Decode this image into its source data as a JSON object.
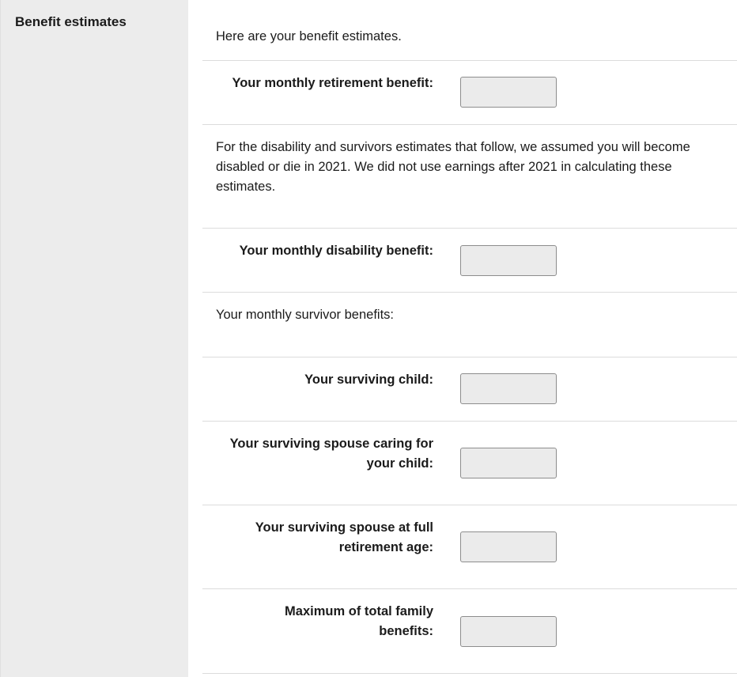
{
  "sidebar": {
    "heading": "Benefit estimates"
  },
  "main": {
    "intro": "Here are your benefit estimates.",
    "retirement": {
      "label": "Your monthly retirement benefit:",
      "value": ""
    },
    "disability_note": "For the disability and survivors estimates that follow, we assumed you will become disabled or die in 2021. We did not use earnings after 2021 in calculating these estimates.",
    "disability": {
      "label": "Your monthly disability benefit:",
      "value": ""
    },
    "survivor_heading": "Your monthly survivor benefits:",
    "surviving_child": {
      "label": "Your surviving child:",
      "value": ""
    },
    "spouse_caring": {
      "label": "Your surviving spouse caring for your child:",
      "value": ""
    },
    "spouse_full_age": {
      "label": "Your surviving spouse at full retirement age:",
      "value": ""
    },
    "family_max": {
      "label": "Maximum of total family benefits:",
      "value": ""
    }
  }
}
